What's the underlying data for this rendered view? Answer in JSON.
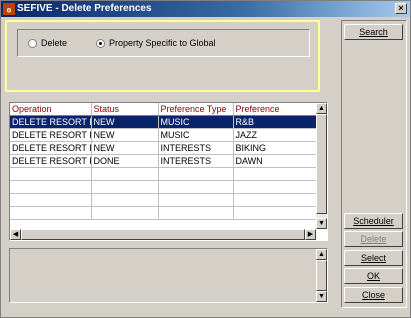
{
  "window": {
    "title": "SEFIVE - Delete Preferences",
    "icon": "opera-app-icon"
  },
  "criteria": {
    "options": [
      {
        "label": "Delete",
        "selected": false
      },
      {
        "label": "Property Specific to Global",
        "selected": true
      }
    ]
  },
  "grid": {
    "columns": [
      "Operation",
      "Status",
      "Preference Type",
      "Preference"
    ],
    "rows": [
      [
        "DELETE RESORT P",
        "NEW",
        "MUSIC",
        "R&B"
      ],
      [
        "DELETE RESORT P",
        "NEW",
        "MUSIC",
        "JAZZ"
      ],
      [
        "DELETE RESORT P",
        "NEW",
        "INTERESTS",
        "BIKING"
      ],
      [
        "DELETE RESORT P",
        "DONE",
        "INTERESTS",
        "DAWN"
      ]
    ],
    "selected_row": 0
  },
  "buttons": {
    "search": "Search",
    "scheduler": "Scheduler",
    "delete": "Delete",
    "select": "Select",
    "ok": "OK",
    "close": "Close"
  },
  "colors": {
    "header_text": "#8b0000",
    "selection": "#0a246a",
    "criteria_highlight": "#ffff9e"
  }
}
